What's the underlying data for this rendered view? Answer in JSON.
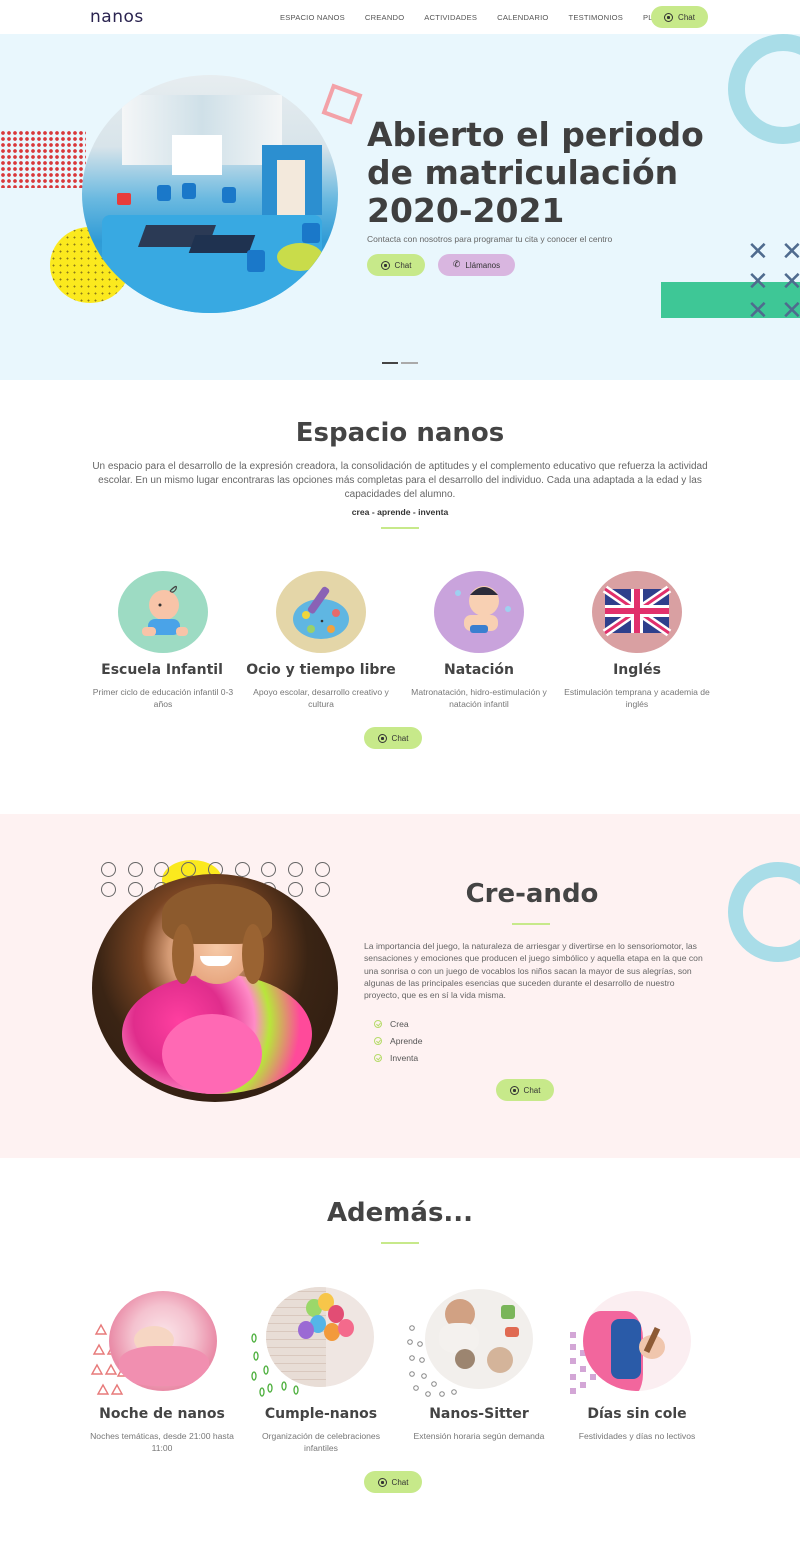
{
  "header": {
    "logo": "nanos",
    "nav": [
      "ESPACIO NANOS",
      "CREANDO",
      "ACTIVIDADES",
      "CALENDARIO",
      "TESTIMONIOS",
      "PLANES"
    ],
    "chat_label": "Chat"
  },
  "hero": {
    "title": "Abierto el periodo de matriculación 2020-2021",
    "subtitle": "Contacta con nosotros para programar tu cita y conocer el centro",
    "chat_label": "Chat",
    "call_label": "Llámanos",
    "slider_active": 1,
    "slider_count": 2
  },
  "espacio": {
    "title": "Espacio nanos",
    "description": "Un espacio para el desarrollo de la expresión creadora, la consolidación de aptitudes y el complemento educativo que refuerza la actividad escolar. En un mismo lugar encontraras las opciones más completas para el desarrollo del individuo. Cada una adaptada a la edad y las capacidades del alumno.",
    "tagline": "crea - aprende - inventa",
    "cards": [
      {
        "title": "Escuela Infantil",
        "desc": "Primer ciclo de educación infantil 0-3 años",
        "icon": "baby-icon",
        "color": "#9ddbc3"
      },
      {
        "title": "Ocio y tiempo libre",
        "desc": "Apoyo escolar, desarrollo creativo y cultura",
        "icon": "paint-palette-icon",
        "color": "#e4d6a8"
      },
      {
        "title": "Natación",
        "desc": "Matronatación, hidro-estimulación y natación infantil",
        "icon": "swimming-baby-icon",
        "color": "#c9a3dc"
      },
      {
        "title": "Inglés",
        "desc": "Estimulación temprana y academia de inglés",
        "icon": "uk-flag-icon",
        "color": "#d9a0a2"
      }
    ],
    "chat_label": "Chat"
  },
  "creando": {
    "title": "Cre-ando",
    "description": "La importancia del juego, la naturaleza de arriesgar y divertirse en lo sensoriomotor, las sensaciones y emociones que producen el juego simbólico y aquella etapa en la que con una sonrisa o con un juego de vocablos los niños sacan la mayor de sus alegrías, son algunas de las principales esencias que suceden durante el desarrollo de nuestro proyecto, que es en sí la vida misma.",
    "list": [
      "Crea",
      "Aprende",
      "Inventa"
    ],
    "chat_label": "Chat"
  },
  "ademas": {
    "title": "Además...",
    "cards": [
      {
        "title": "Noche de nanos",
        "desc": "Noches temáticas, desde 21:00 hasta 11:00"
      },
      {
        "title": "Cumple-nanos",
        "desc": "Organización de celebraciones infantiles"
      },
      {
        "title": "Nanos-Sitter",
        "desc": "Extensión horaria según demanda"
      },
      {
        "title": "Días sin cole",
        "desc": "Festividades y días no lectivos"
      }
    ],
    "chat_label": "Chat"
  },
  "colors": {
    "accent_green": "#c7e98a",
    "accent_purple": "#d9b6e0",
    "hero_bg": "#e9f7fd",
    "creando_bg": "#fef2f2",
    "text_dark": "#444444"
  }
}
